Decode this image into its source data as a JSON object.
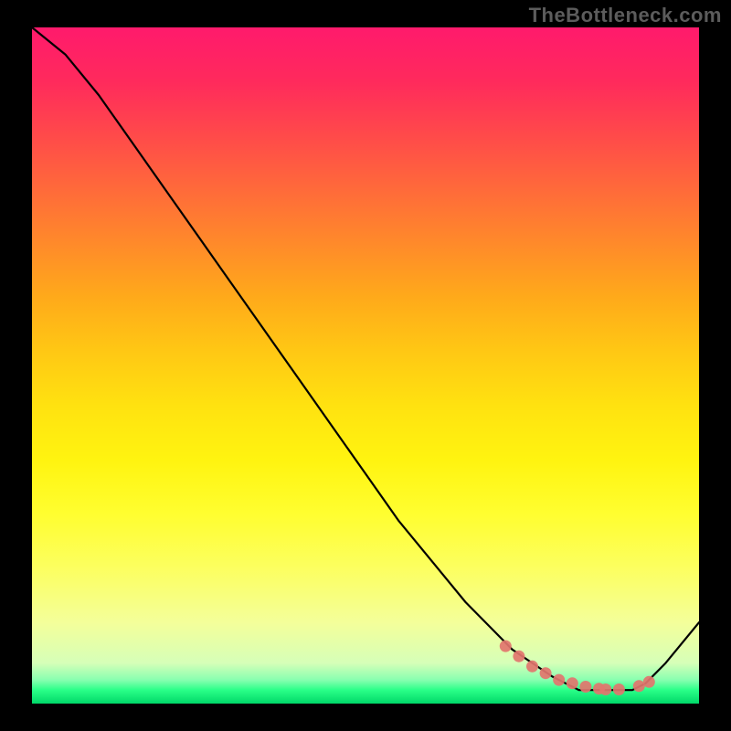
{
  "attribution": "TheBottleneck.com",
  "colors": {
    "frame": "#000000",
    "curve": "#000000",
    "marker": "#e2756e",
    "gradient_top": "#ff1a6c",
    "gradient_bottom": "#00d868"
  },
  "chart_data": {
    "type": "line",
    "title": "",
    "xlabel": "",
    "ylabel": "",
    "xlim": [
      0,
      100
    ],
    "ylim": [
      0,
      100
    ],
    "x": [
      0,
      5,
      10,
      15,
      20,
      25,
      30,
      35,
      40,
      45,
      50,
      55,
      60,
      65,
      70,
      72,
      75,
      78,
      80,
      82,
      85,
      88,
      90,
      92,
      95,
      100
    ],
    "values": [
      100,
      96,
      90,
      83,
      76,
      69,
      62,
      55,
      48,
      41,
      34,
      27,
      21,
      15,
      10,
      8,
      6,
      4,
      3,
      2,
      2,
      2,
      2,
      3,
      6,
      12
    ],
    "markers_x": [
      71,
      73,
      75,
      77,
      79,
      81,
      83,
      85,
      86,
      88,
      91,
      92.5
    ],
    "markers_y": [
      8.5,
      7,
      5.5,
      4.5,
      3.5,
      3,
      2.5,
      2.2,
      2.1,
      2.1,
      2.6,
      3.2
    ],
    "gradient_stops": [
      {
        "pos": 0,
        "color": "#ff1a6c"
      },
      {
        "pos": 0.5,
        "color": "#ffe210"
      },
      {
        "pos": 0.9,
        "color": "#f4ff9a"
      },
      {
        "pos": 1.0,
        "color": "#00d868"
      }
    ]
  }
}
